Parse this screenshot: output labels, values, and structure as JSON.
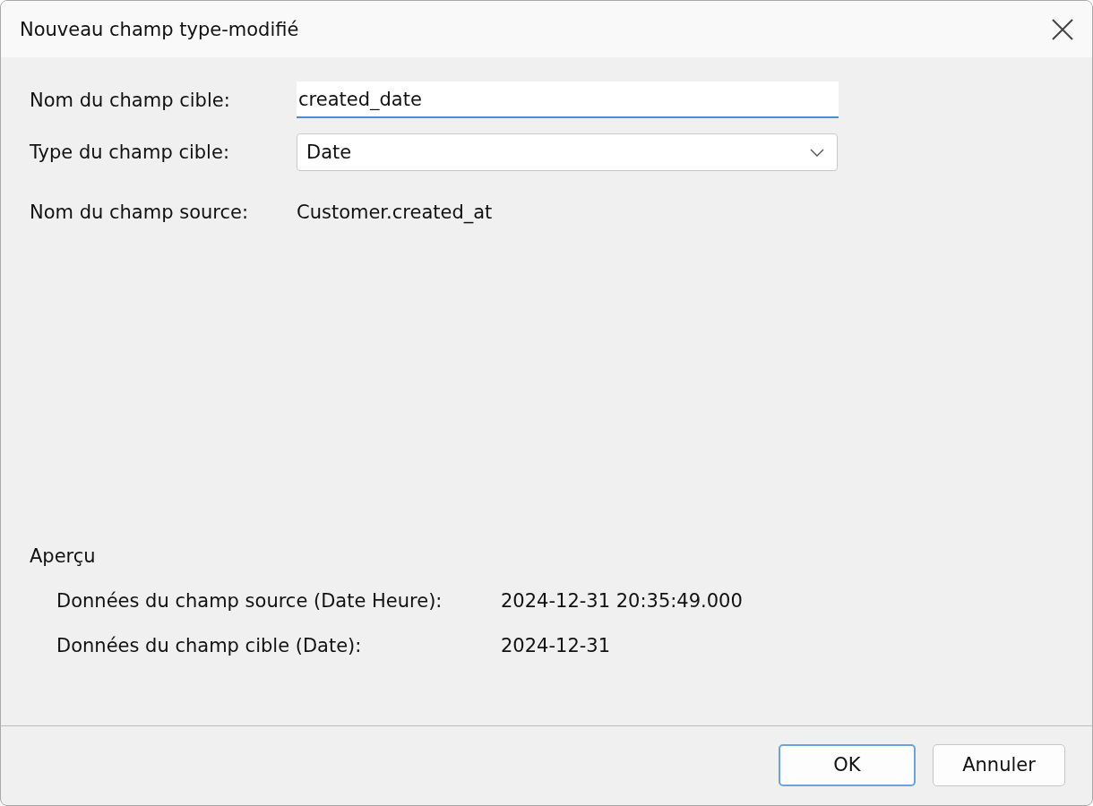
{
  "window": {
    "title": "Nouveau champ type-modifié"
  },
  "fields": [
    {
      "kind": "input",
      "label": "Nom du champ cible:",
      "value": "created_date"
    },
    {
      "kind": "select",
      "label": "Type du champ cible:",
      "value": "Date"
    },
    {
      "kind": "text",
      "label": "Nom du champ source:",
      "value": "Customer.created_at"
    }
  ],
  "preview": {
    "title": "Aperçu",
    "rows": [
      {
        "label": "Données du champ source (Date Heure):",
        "value": "2024-12-31 20:35:49.000"
      },
      {
        "label": "Données du champ cible (Date):",
        "value": "2024-12-31"
      }
    ]
  },
  "buttons": [
    {
      "label": "OK",
      "default": true
    },
    {
      "label": "Annuler",
      "default": false
    }
  ]
}
